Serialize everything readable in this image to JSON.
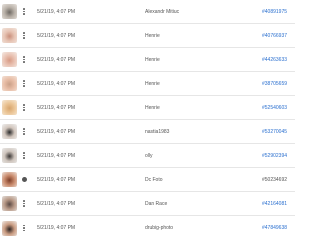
{
  "rows": [
    {
      "date": "5/21/19, 4:07 PM",
      "author": "Alexandr Mitiuc",
      "id": "#40891975",
      "thumb_colors": [
        "#e9e4df",
        "#b9b1a8",
        "#6f6a64"
      ],
      "menu": "dots"
    },
    {
      "date": "5/21/19, 4:07 PM",
      "author": "Henrie",
      "id": "#40766937",
      "thumb_colors": [
        "#f2e6de",
        "#e7c4b4",
        "#c98f7b"
      ],
      "menu": "dots"
    },
    {
      "date": "5/21/19, 4:07 PM",
      "author": "Henrie",
      "id": "#44263633",
      "thumb_colors": [
        "#f5ece6",
        "#e9c1b1",
        "#d79a84"
      ],
      "menu": "dots"
    },
    {
      "date": "5/21/19, 4:07 PM",
      "author": "Henrie",
      "id": "#38705659",
      "thumb_colors": [
        "#f3e3d8",
        "#e8bda6",
        "#caa088"
      ],
      "menu": "dots"
    },
    {
      "date": "5/21/19, 4:07 PM",
      "author": "Henrie",
      "id": "#52540603",
      "thumb_colors": [
        "#f6ead8",
        "#ebc596",
        "#d7a56d"
      ],
      "menu": "dots"
    },
    {
      "date": "5/21/19, 4:07 PM",
      "author": "nastia1983",
      "id": "#53270045",
      "thumb_colors": [
        "#f1f1f1",
        "#d2c6bd",
        "#2b2b2b"
      ],
      "menu": "dots"
    },
    {
      "date": "5/21/19, 4:07 PM",
      "author": "olly",
      "id": "#52902394",
      "thumb_colors": [
        "#ecebea",
        "#cfc5bd",
        "#3a3634"
      ],
      "menu": "dots"
    },
    {
      "date": "5/21/19, 4:07 PM",
      "author": "Dc Foto",
      "id": "#50234692",
      "thumb_colors": [
        "#f0e4dc",
        "#c98b6d",
        "#7e3e28"
      ],
      "menu": "info"
    },
    {
      "date": "5/21/19, 4:07 PM",
      "author": "Dan Race",
      "id": "#42164081",
      "thumb_colors": [
        "#e6e2de",
        "#b99a88",
        "#5b4a44"
      ],
      "menu": "dots"
    },
    {
      "date": "5/21/19, 4:07 PM",
      "author": "drubig-photo",
      "id": "#47849638",
      "thumb_colors": [
        "#f1ebe6",
        "#c99b81",
        "#2d2422"
      ],
      "menu": "dots"
    }
  ],
  "colors": {
    "id_link": "#2a6fcf",
    "divider": "#e6e6e6"
  }
}
